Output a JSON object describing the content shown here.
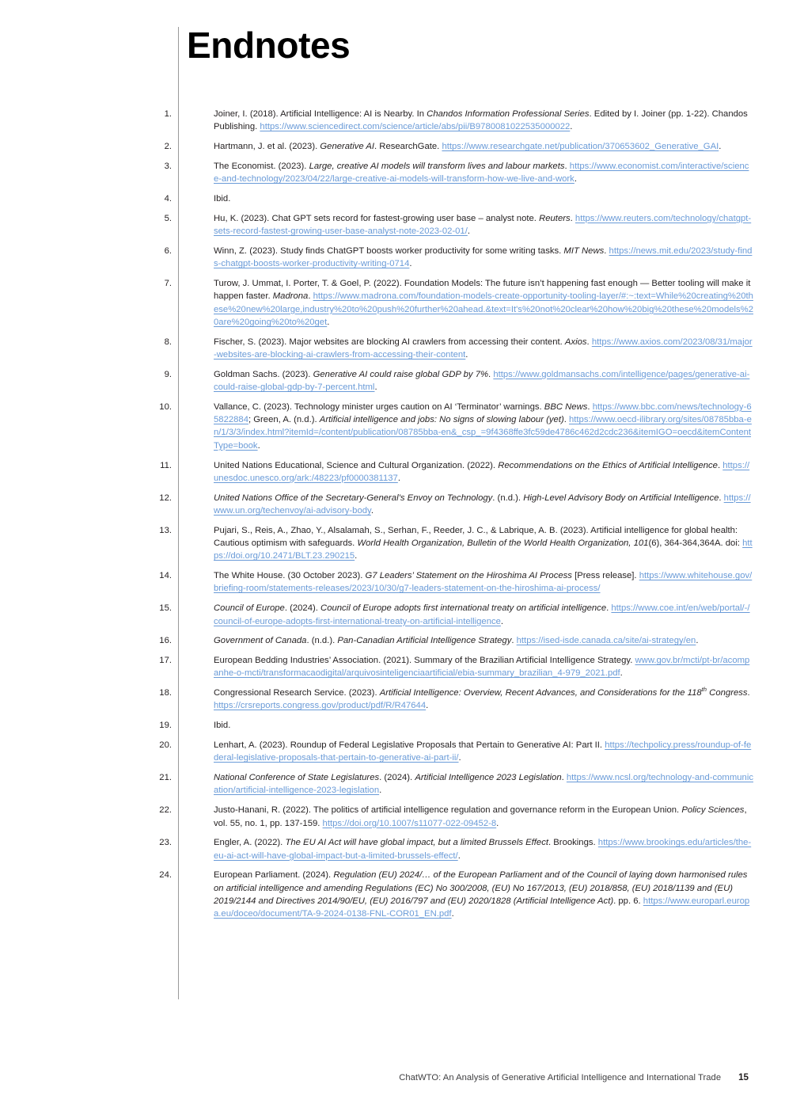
{
  "document": {
    "heading": "Endnotes",
    "footer_title": "ChatWTO: An Analysis of Generative Artificial Intelligence and International Trade",
    "page_number": "15",
    "link_color": "#6a9bd8",
    "text_color": "#231f20",
    "rule_color": "#9a9a9a"
  },
  "endnotes": [
    {
      "number": "1.",
      "segments": [
        {
          "t": "Joiner, I. (2018). Artificial Intelligence: AI is Nearby. In ",
          "s": "normal"
        },
        {
          "t": "Chandos Information Professional Series",
          "s": "italic"
        },
        {
          "t": ". Edited by I. Joiner (pp. 1-22). Chandos Publishing. ",
          "s": "normal"
        },
        {
          "t": "https://www.sciencedirect.com/science/article/abs/pii/B9780081022535000022",
          "s": "link"
        },
        {
          "t": ".",
          "s": "normal"
        }
      ]
    },
    {
      "number": "2.",
      "segments": [
        {
          "t": "Hartmann, J. et al. (2023). ",
          "s": "normal"
        },
        {
          "t": "Generative AI",
          "s": "italic"
        },
        {
          "t": ". ResearchGate. ",
          "s": "normal"
        },
        {
          "t": "https://www.researchgate.net/publication/370653602_Generative_GAI",
          "s": "link"
        },
        {
          "t": ".",
          "s": "normal"
        }
      ]
    },
    {
      "number": "3.",
      "segments": [
        {
          "t": "The Economist. (2023). ",
          "s": "normal"
        },
        {
          "t": "Large, creative AI models will transform lives and labour markets",
          "s": "italic"
        },
        {
          "t": ". ",
          "s": "normal"
        },
        {
          "t": "https://www.economist.com/interactive/science-and-technology/2023/04/22/large-creative-ai-models-will-transform-how-we-live-and-work",
          "s": "link"
        },
        {
          "t": ".",
          "s": "normal"
        }
      ]
    },
    {
      "number": "4.",
      "segments": [
        {
          "t": "Ibid.",
          "s": "normal"
        }
      ]
    },
    {
      "number": "5.",
      "segments": [
        {
          "t": "Hu, K. (2023). Chat GPT sets record for fastest-growing user base – analyst note. ",
          "s": "normal"
        },
        {
          "t": "Reuters",
          "s": "italic"
        },
        {
          "t": ". ",
          "s": "normal"
        },
        {
          "t": "https://www.reuters.com/technology/chatgpt-sets-record-fastest-growing-user-base-analyst-note-2023-02-01/",
          "s": "link"
        },
        {
          "t": ".",
          "s": "normal"
        }
      ]
    },
    {
      "number": "6.",
      "segments": [
        {
          "t": "Winn, Z. (2023). Study finds ChatGPT boosts worker productivity for some writing tasks. ",
          "s": "normal"
        },
        {
          "t": "MIT News",
          "s": "italic"
        },
        {
          "t": ". ",
          "s": "normal"
        },
        {
          "t": "https://news.mit.edu/2023/study-finds-chatgpt-boosts-worker-productivity-writing-0714",
          "s": "link"
        },
        {
          "t": ".",
          "s": "normal"
        }
      ]
    },
    {
      "number": "7.",
      "segments": [
        {
          "t": "Turow, J. Ummat, I. Porter, T. & Goel, P. (2022). Foundation Models: The future isn’t happening fast enough — Better tooling will make it happen faster. ",
          "s": "normal"
        },
        {
          "t": "Madrona",
          "s": "italic"
        },
        {
          "t": ". ",
          "s": "normal"
        },
        {
          "t": "https://www.madrona.com/foundation-models-create-opportunity-tooling-layer/#:~:text=While%20creating%20these%20new%20large,industry%20to%20push%20further%20ahead.&text=It's%20not%20clear%20how%20big%20these%20models%20are%20going%20to%20get",
          "s": "link"
        },
        {
          "t": ".",
          "s": "normal"
        }
      ]
    },
    {
      "number": "8.",
      "segments": [
        {
          "t": "Fischer, S. (2023). Major websites are blocking AI crawlers from accessing their content. ",
          "s": "normal"
        },
        {
          "t": "Axios",
          "s": "italic"
        },
        {
          "t": ". ",
          "s": "normal"
        },
        {
          "t": "https://www.axios.com/2023/08/31/major-websites-are-blocking-ai-crawlers-from-accessing-their-content",
          "s": "link"
        },
        {
          "t": ".",
          "s": "normal"
        }
      ]
    },
    {
      "number": "9.",
      "segments": [
        {
          "t": "Goldman Sachs. (2023). ",
          "s": "normal"
        },
        {
          "t": "Generative AI could raise global GDP by 7%",
          "s": "italic"
        },
        {
          "t": ". ",
          "s": "normal"
        },
        {
          "t": "https://www.goldmansachs.com/intelligence/pages/generative-ai-could-raise-global-gdp-by-7-percent.html",
          "s": "link"
        },
        {
          "t": ".",
          "s": "normal"
        }
      ]
    },
    {
      "number": "10.",
      "segments": [
        {
          "t": "Vallance, C. (2023). Technology minister urges caution on AI ‘Terminator’ warnings. ",
          "s": "normal"
        },
        {
          "t": "BBC News",
          "s": "italic"
        },
        {
          "t": ". ",
          "s": "normal"
        },
        {
          "t": "https://www.bbc.com/news/technology-65822884",
          "s": "link"
        },
        {
          "t": "; Green, A. (n.d.). ",
          "s": "normal"
        },
        {
          "t": "Artificial intelligence and jobs: No signs of slowing labour (yet)",
          "s": "italic"
        },
        {
          "t": ". ",
          "s": "normal"
        },
        {
          "t": "https://www.oecd-ilibrary.org/sites/08785bba-en/1/3/3/index.html?itemId=/content/publication/08785bba-en&_csp_=9f4368ffe3fc59de4786c462d2cdc236&itemIGO=oecd&itemContentType=book",
          "s": "link"
        },
        {
          "t": ".",
          "s": "normal"
        }
      ]
    },
    {
      "number": "11.",
      "segments": [
        {
          "t": "United Nations Educational, Science and Cultural Organization. (2022). ",
          "s": "normal"
        },
        {
          "t": "Recommendations on the Ethics of Artificial Intelligence",
          "s": "italic"
        },
        {
          "t": ". ",
          "s": "normal"
        },
        {
          "t": "https://unesdoc.unesco.org/ark:/48223/pf0000381137",
          "s": "link"
        },
        {
          "t": ".",
          "s": "normal"
        }
      ]
    },
    {
      "number": "12.",
      "segments": [
        {
          "t": "United Nations Office of the Secretary-General’s Envoy on Technology",
          "s": "italic"
        },
        {
          "t": ". (n.d.). ",
          "s": "normal"
        },
        {
          "t": "High-Level Advisory Body on Artificial Intelligence",
          "s": "italic"
        },
        {
          "t": ". ",
          "s": "normal"
        },
        {
          "t": "https://www.un.org/techenvoy/ai-advisory-body",
          "s": "link"
        },
        {
          "t": ".",
          "s": "normal"
        }
      ]
    },
    {
      "number": "13.",
      "segments": [
        {
          "t": "Pujari, S., Reis, A., Zhao, Y., Alsalamah, S., Serhan, F., Reeder, J. C., & Labrique, A. B. (2023). Artificial intelligence for global health: Cautious optimism with safeguards. ",
          "s": "normal"
        },
        {
          "t": "World Health Organization, Bulletin of the World Health Organization, 101",
          "s": "italic"
        },
        {
          "t": "(6), 364-364,364A. doi: ",
          "s": "normal"
        },
        {
          "t": "https://doi.org/10.2471/BLT.23.290215",
          "s": "link"
        },
        {
          "t": ".",
          "s": "normal"
        }
      ]
    },
    {
      "number": "14.",
      "segments": [
        {
          "t": "The White House. (30 October 2023). ",
          "s": "normal"
        },
        {
          "t": "G7 Leaders’ Statement on the Hiroshima AI Process",
          "s": "italic"
        },
        {
          "t": " [Press release]. ",
          "s": "normal"
        },
        {
          "t": "https://www.whitehouse.gov/briefing-room/statements-releases/2023/10/30/g7-leaders-statement-on-the-hiroshima-ai-process/",
          "s": "link"
        },
        {
          "t": "",
          "s": "normal"
        }
      ]
    },
    {
      "number": "15.",
      "segments": [
        {
          "t": "Council of Europe",
          "s": "italic"
        },
        {
          "t": ". (2024). ",
          "s": "normal"
        },
        {
          "t": "Council of Europe adopts first international treaty on artificial intelligence",
          "s": "italic"
        },
        {
          "t": ". ",
          "s": "normal"
        },
        {
          "t": "https://www.coe.int/en/web/portal/-/council-of-europe-adopts-first-international-treaty-on-artificial-intelligence",
          "s": "link"
        },
        {
          "t": ".",
          "s": "normal"
        }
      ]
    },
    {
      "number": "16.",
      "segments": [
        {
          "t": "Government of Canada",
          "s": "italic"
        },
        {
          "t": ". (n.d.). ",
          "s": "normal"
        },
        {
          "t": "Pan-Canadian Artificial Intelligence Strategy",
          "s": "italic"
        },
        {
          "t": ". ",
          "s": "normal"
        },
        {
          "t": "https://ised-isde.canada.ca/site/ai-strategy/en",
          "s": "link"
        },
        {
          "t": ".",
          "s": "normal"
        }
      ]
    },
    {
      "number": "17.",
      "segments": [
        {
          "t": "European Bedding Industries’ Association. (2021). Summary of the Brazilian Artificial Intelligence Strategy. ",
          "s": "normal"
        },
        {
          "t": "www.gov.br/mcti/pt-br/acompanhe-o-mcti/transformacaodigital/arquivosinteligenciaartificial/ebia-summary_brazilian_4-979_2021.pdf",
          "s": "link"
        },
        {
          "t": ".",
          "s": "normal"
        }
      ]
    },
    {
      "number": "18.",
      "segments": [
        {
          "t": "Congressional Research Service. (2023). ",
          "s": "normal"
        },
        {
          "t": "Artificial Intelligence: Overview, Recent Advances, and Considerations for the 118",
          "s": "italic"
        },
        {
          "t": "th",
          "s": "superscript-italic"
        },
        {
          "t": " Congress",
          "s": "italic"
        },
        {
          "t": ". ",
          "s": "normal"
        },
        {
          "t": "https://crsreports.congress.gov/product/pdf/R/R47644",
          "s": "link"
        },
        {
          "t": ".",
          "s": "normal"
        }
      ]
    },
    {
      "number": "19.",
      "segments": [
        {
          "t": "Ibid.",
          "s": "normal"
        }
      ]
    },
    {
      "number": "20.",
      "segments": [
        {
          "t": "Lenhart, A. (2023). Roundup of Federal Legislative Proposals that Pertain to Generative AI: Part II. ",
          "s": "normal"
        },
        {
          "t": "https://techpolicy.press/roundup-of-federal-legislative-proposals-that-pertain-to-generative-ai-part-ii/",
          "s": "link"
        },
        {
          "t": ".",
          "s": "normal"
        }
      ]
    },
    {
      "number": "21.",
      "segments": [
        {
          "t": "National Conference of State Legislatures",
          "s": "italic"
        },
        {
          "t": ". (2024). ",
          "s": "normal"
        },
        {
          "t": "Artificial Intelligence 2023 Legislation",
          "s": "italic"
        },
        {
          "t": ". ",
          "s": "normal"
        },
        {
          "t": "https://www.ncsl.org/technology-and-communication/artificial-intelligence-2023-legislation",
          "s": "link"
        },
        {
          "t": ".",
          "s": "normal"
        }
      ]
    },
    {
      "number": "22.",
      "segments": [
        {
          "t": "Justo-Hanani, R. (2022). The politics of artificial intelligence regulation and governance reform in the European Union. ",
          "s": "normal"
        },
        {
          "t": "Policy Sciences",
          "s": "italic"
        },
        {
          "t": ", vol. 55, no. 1, pp. 137-159. ",
          "s": "normal"
        },
        {
          "t": "https://doi.org/10.1007/s11077-022-09452-8",
          "s": "link"
        },
        {
          "t": ".",
          "s": "normal"
        }
      ]
    },
    {
      "number": "23.",
      "segments": [
        {
          "t": "Engler, A. (2022). ",
          "s": "normal"
        },
        {
          "t": "The EU AI Act will have global impact, but a limited Brussels Effect",
          "s": "italic"
        },
        {
          "t": ". Brookings. ",
          "s": "normal"
        },
        {
          "t": "https://www.brookings.edu/articles/the-eu-ai-act-will-have-global-impact-but-a-limited-brussels-effect/",
          "s": "link"
        },
        {
          "t": ".",
          "s": "normal"
        }
      ]
    },
    {
      "number": "24.",
      "segments": [
        {
          "t": "European Parliament. (2024). ",
          "s": "normal"
        },
        {
          "t": "Regulation (EU) 2024/… of the European Parliament and of the Council of laying down harmonised rules on artificial intelligence and amending Regulations (EC) No 300/2008, (EU) No 167/2013, (EU) 2018/858, (EU) 2018/1139 and (EU) 2019/2144 and Directives 2014/90/EU, (EU) 2016/797 and (EU) 2020/1828 (Artificial Intelligence Act)",
          "s": "italic"
        },
        {
          "t": ". pp. 6. ",
          "s": "normal"
        },
        {
          "t": "https://www.europarl.europa.eu/doceo/document/TA-9-2024-0138-FNL-COR01_EN.pdf",
          "s": "link"
        },
        {
          "t": ".",
          "s": "normal"
        }
      ]
    }
  ]
}
